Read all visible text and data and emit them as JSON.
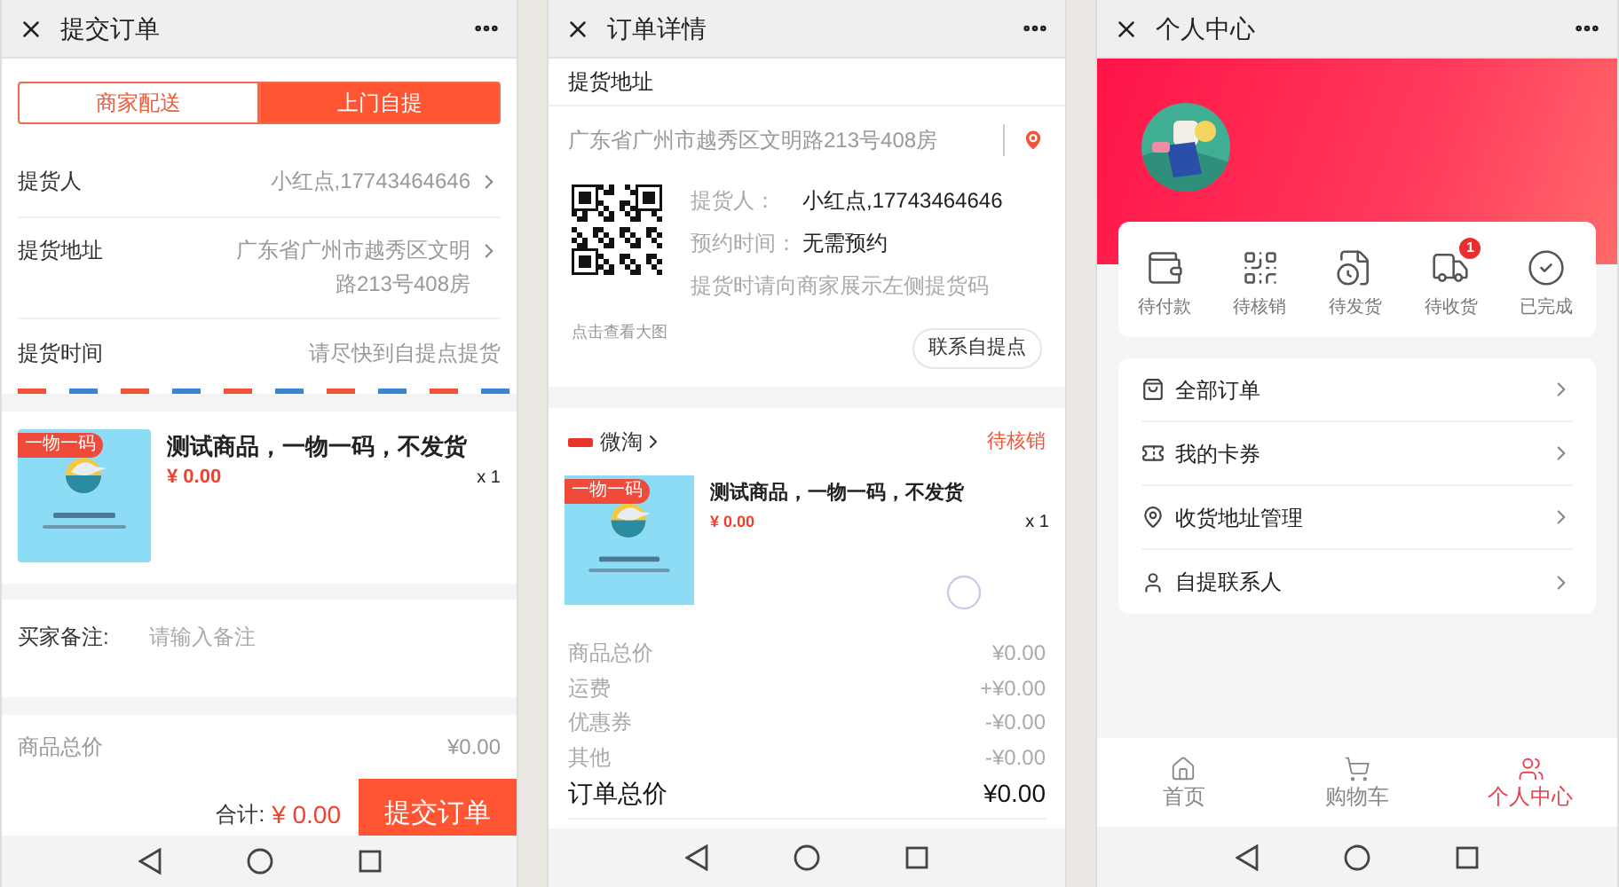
{
  "submit_order": {
    "title": "提交订单",
    "delivery_tabs": [
      {
        "label": "商家配送",
        "selected": false
      },
      {
        "label": "上门自提",
        "selected": true
      }
    ],
    "fields": [
      {
        "label": "提货人",
        "value": "小红点,17743464646",
        "chevron": true
      },
      {
        "label": "提货地址",
        "value": "广东省广州市越秀区文明路213号408房",
        "chevron": true
      },
      {
        "label": "提货时间",
        "value": "请尽快到自提点提货",
        "chevron": false
      }
    ],
    "product": {
      "badge": "一物一码",
      "name": "测试商品，一物一码，不发货",
      "price": "¥ 0.00",
      "quantity": "x 1"
    },
    "remark": {
      "label": "买家备注:",
      "placeholder": "请输入备注"
    },
    "subtotal": {
      "label": "商品总价",
      "value": "¥0.00"
    },
    "footer": {
      "total_label": "合计:",
      "total": "¥ 0.00",
      "submit": "提交订单"
    }
  },
  "order_detail": {
    "title": "订单详情",
    "section_title": "提货地址",
    "address": "广东省广州市越秀区文明路213号408房",
    "pickup_info": [
      {
        "label": "提货人：",
        "value": "小红点,17743464646"
      },
      {
        "label": "预约时间：",
        "value": "无需预约"
      }
    ],
    "hint": "提货时请向商家展示左侧提货码",
    "qr_caption": "点击查看大图",
    "contact_button": "联系自提点",
    "shop": {
      "name": "微淘",
      "status": "待核销"
    },
    "product": {
      "badge": "一物一码",
      "name": "测试商品，一物一码，不发货",
      "price": "¥ 0.00",
      "quantity": "x 1"
    },
    "price_rows": [
      {
        "label": "商品总价",
        "value": "¥0.00"
      },
      {
        "label": "运费",
        "value": "+¥0.00"
      },
      {
        "label": "优惠券",
        "value": "-¥0.00"
      },
      {
        "label": "其他",
        "value": "-¥0.00"
      }
    ],
    "total": {
      "label": "订单总价",
      "value": "¥0.00"
    }
  },
  "profile": {
    "title": "个人中心",
    "order_status": [
      {
        "label": "待付款",
        "kind": "wallet"
      },
      {
        "label": "待核销",
        "kind": "qr"
      },
      {
        "label": "待发货",
        "kind": "invoice"
      },
      {
        "label": "待收货",
        "kind": "truck",
        "badge": "1"
      },
      {
        "label": "已完成",
        "kind": "done"
      }
    ],
    "menu": [
      {
        "label": "全部订单",
        "kind": "bag"
      },
      {
        "label": "我的卡券",
        "kind": "ticket"
      },
      {
        "label": "收货地址管理",
        "kind": "pin"
      },
      {
        "label": "自提联系人",
        "kind": "user"
      }
    ],
    "tabs": [
      {
        "label": "首页",
        "kind": "home",
        "selected": false
      },
      {
        "label": "购物车",
        "kind": "cart",
        "selected": false
      },
      {
        "label": "个人中心",
        "kind": "users",
        "selected": true
      }
    ]
  }
}
